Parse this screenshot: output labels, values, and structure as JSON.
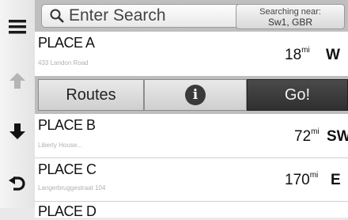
{
  "search": {
    "placeholder": "Enter Search"
  },
  "near": {
    "line1": "Searching near:",
    "line2": "Sw1, GBR"
  },
  "places": [
    {
      "name": "PLACE A",
      "address": "433 Landon Road",
      "distance": "18",
      "unit": "mi",
      "direction": "W"
    },
    {
      "name": "PLACE B",
      "address": "Liberty House...",
      "distance": "72",
      "unit": "mi",
      "direction": "SW"
    },
    {
      "name": "PLACE C",
      "address": "Langerbruggestraat 104",
      "distance": "170",
      "unit": "mi",
      "direction": "E"
    },
    {
      "name": "PLACE D"
    }
  ],
  "actions": {
    "routes_label": "Routes",
    "info_label": "i",
    "go_label": "Go!"
  },
  "icons": {
    "menu": "hamburger-menu-icon",
    "scroll_up": "arrow-up-icon",
    "scroll_down": "arrow-down-icon",
    "back": "back-arrow-icon",
    "search": "search-icon",
    "info": "info-icon"
  },
  "colors": {
    "go_button": "#353535",
    "topbar": "#bfbfbf",
    "disabled_arrow": "#b5b5b5"
  }
}
